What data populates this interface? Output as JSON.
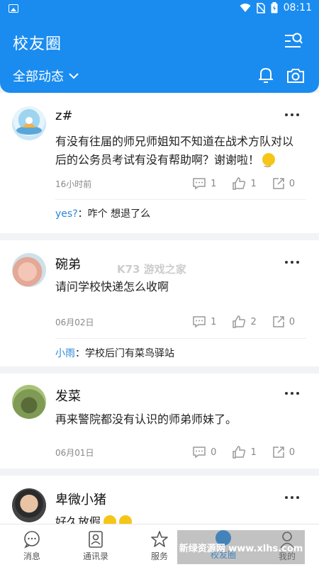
{
  "status_bar": {
    "time": "08:11",
    "battery_icon": "battery-icon",
    "wifi_icon": "wifi-icon"
  },
  "header": {
    "title": "校友圈",
    "filter_label": "全部动态",
    "search_icon": "search-list-icon",
    "bell_icon": "bell-icon",
    "camera_icon": "camera-icon"
  },
  "posts": [
    {
      "username": "z#",
      "content": "有没有往届的师兄师姐知不知道在战术方队对以后的公务员考试有没有帮助啊？谢谢啦！",
      "has_emoji": true,
      "date": "16小时前",
      "comments_count": "1",
      "likes_count": "1",
      "shares_count": "0",
      "reply": {
        "author": "yes?",
        "sep": "：",
        "text": "咋个 想退了么"
      }
    },
    {
      "username": "碗弟",
      "content": "请问学校快递怎么收啊",
      "date": "06月02日",
      "comments_count": "1",
      "likes_count": "2",
      "shares_count": "0",
      "reply": {
        "author": "小雨",
        "sep": "：",
        "text": "学校后门有菜鸟驿站"
      }
    },
    {
      "username": "发菜",
      "content": "再来警院都没有认识的师弟师妹了。",
      "date": "06月01日",
      "comments_count": "0",
      "likes_count": "1",
      "shares_count": "0"
    },
    {
      "username": "卑微小猪",
      "content": "好久放假"
    }
  ],
  "tabs": [
    {
      "label": "消息",
      "icon": "message-icon"
    },
    {
      "label": "通讯录",
      "icon": "contacts-icon"
    },
    {
      "label": "服务",
      "icon": "star-icon"
    },
    {
      "label": "校友圈",
      "icon": "alumni-circle-icon",
      "active": true
    },
    {
      "label": "我的",
      "icon": "profile-icon"
    }
  ],
  "watermarks": {
    "center": "K73 游戏之家",
    "bottom": "新绿资源网 www.xlhs.com"
  },
  "colors": {
    "primary": "#1a8cf0",
    "link": "#2a86d9",
    "emoji": "#f5c518"
  }
}
